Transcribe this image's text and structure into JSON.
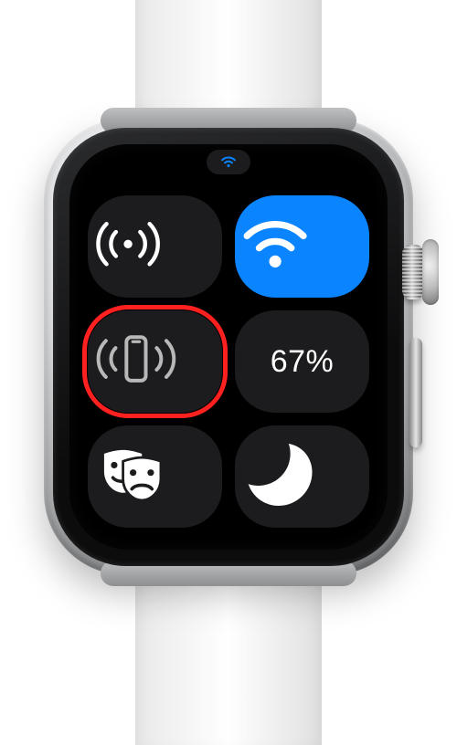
{
  "status": {
    "wifi_connected": true
  },
  "tiles": {
    "cellular": {
      "name": "cellular-toggle",
      "on": false
    },
    "wifi": {
      "name": "wifi-toggle",
      "on": true
    },
    "ping": {
      "name": "ping-iphone-button",
      "on": false,
      "highlighted": true
    },
    "battery": {
      "name": "battery-level",
      "label": "67%"
    },
    "theater": {
      "name": "theater-mode-toggle",
      "on": false
    },
    "dnd": {
      "name": "do-not-disturb-toggle",
      "on": false
    }
  },
  "colors": {
    "accent": "#0a84ff",
    "highlight": "#ff2020",
    "tile_bg": "#1c1c1e"
  }
}
